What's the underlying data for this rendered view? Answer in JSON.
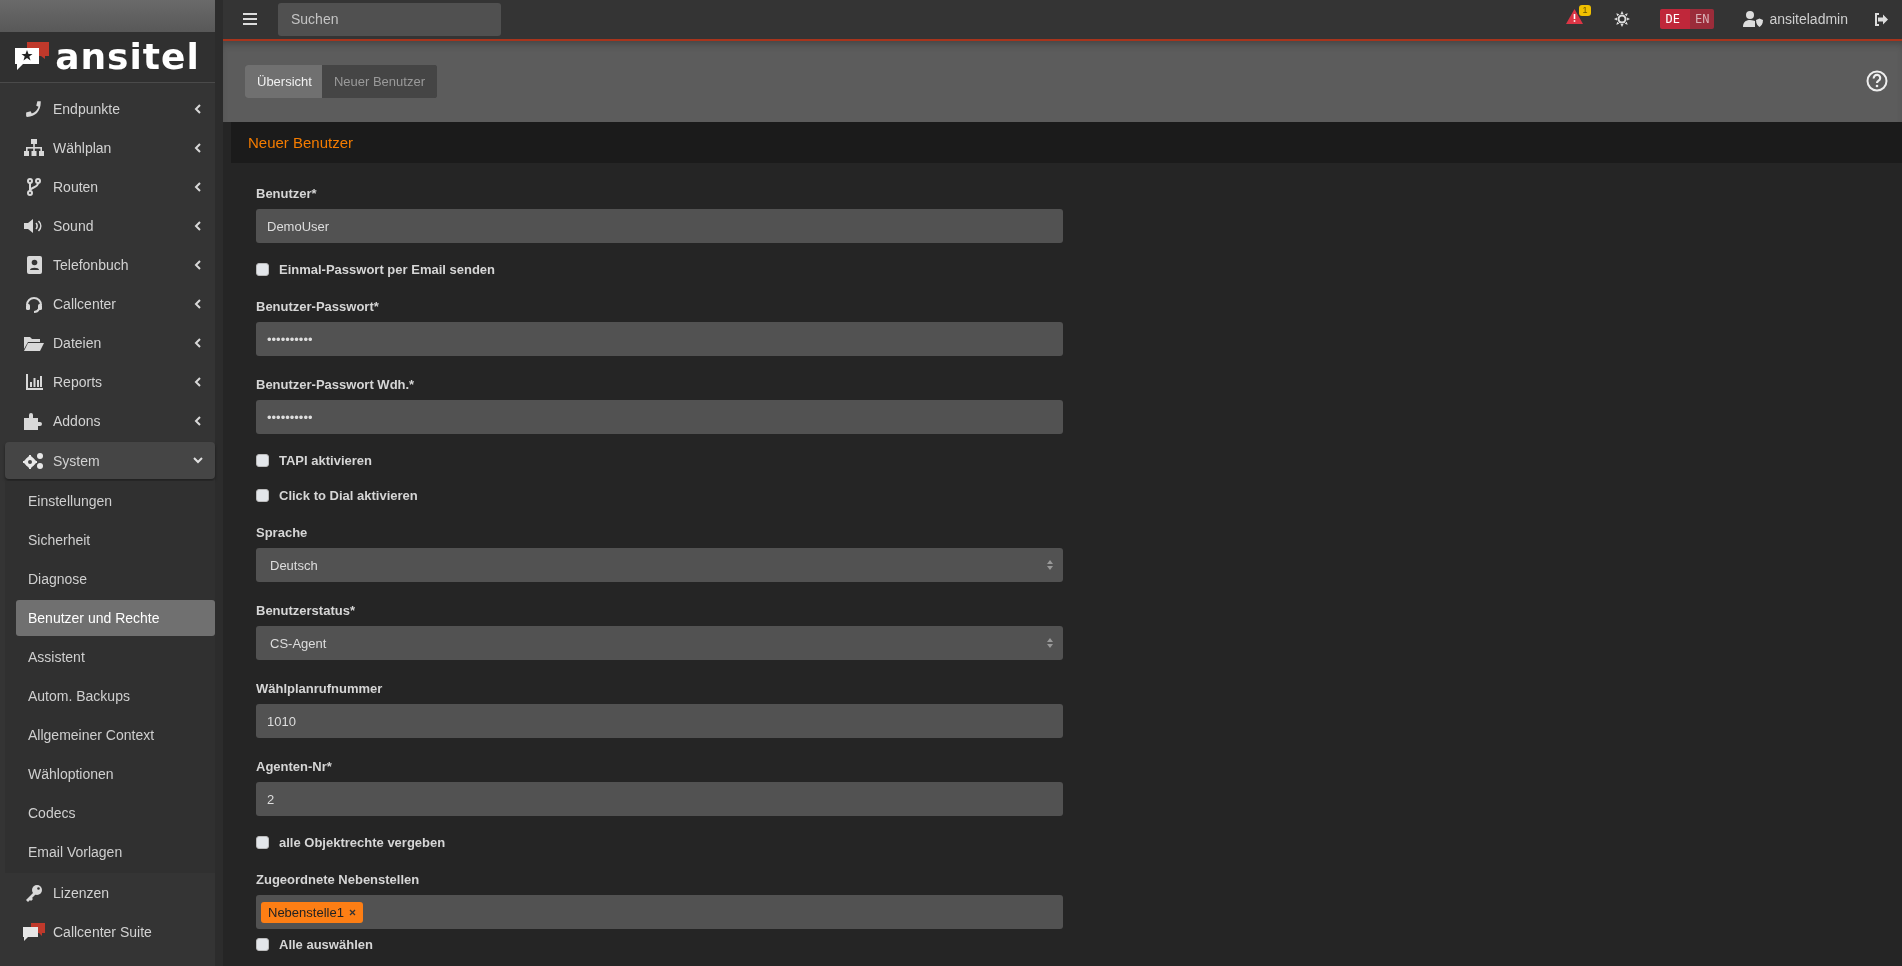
{
  "sidebar": {
    "logo": "ansitel",
    "items": [
      {
        "kind": "group",
        "label": "Endpunkte",
        "expanded": false
      },
      {
        "kind": "group",
        "label": "Wählplan",
        "expanded": false
      },
      {
        "kind": "group",
        "label": "Routen",
        "expanded": false
      },
      {
        "kind": "group",
        "label": "Sound",
        "expanded": false
      },
      {
        "kind": "group",
        "label": "Telefonbuch",
        "expanded": false
      },
      {
        "kind": "group",
        "label": "Callcenter",
        "expanded": false
      },
      {
        "kind": "group",
        "label": "Dateien",
        "expanded": false
      },
      {
        "kind": "group",
        "label": "Reports",
        "expanded": false
      },
      {
        "kind": "group",
        "label": "Addons",
        "expanded": false
      },
      {
        "kind": "group",
        "label": "System",
        "expanded": true,
        "children": [
          {
            "label": "Einstellungen",
            "selected": false
          },
          {
            "label": "Sicherheit",
            "selected": false
          },
          {
            "label": "Diagnose",
            "selected": false
          },
          {
            "label": "Benutzer und Rechte",
            "selected": true
          },
          {
            "label": "Assistent",
            "selected": false
          },
          {
            "label": "Autom. Backups",
            "selected": false
          },
          {
            "label": "Allgemeiner Context",
            "selected": false
          },
          {
            "label": "Wähloptionen",
            "selected": false
          },
          {
            "label": "Codecs",
            "selected": false
          },
          {
            "label": "Email Vorlagen",
            "selected": false
          }
        ]
      },
      {
        "kind": "link",
        "label": "Lizenzen"
      },
      {
        "kind": "link",
        "label": "Callcenter Suite"
      }
    ]
  },
  "topbar": {
    "search": {
      "placeholder": "Suchen"
    },
    "alert_count": "1",
    "languages": [
      {
        "label": "DE",
        "selected": true
      },
      {
        "label": "EN",
        "selected": false
      }
    ],
    "user": "ansiteladmin"
  },
  "tabs": [
    {
      "label": "Übersicht",
      "selected": true
    },
    {
      "label": "Neuer Benutzer",
      "selected": false
    }
  ],
  "form": {
    "title": "Neuer Benutzer",
    "fields": [
      {
        "kind": "text",
        "label": "Benutzer*",
        "value": "DemoUser"
      },
      {
        "kind": "checkbox",
        "label": "Einmal-Passwort per Email senden",
        "checked": false
      },
      {
        "kind": "text",
        "label": "Benutzer-Passwort*",
        "value": "••••••••••"
      },
      {
        "kind": "text",
        "label": "Benutzer-Passwort Wdh.*",
        "value": "••••••••••"
      },
      {
        "kind": "checkbox",
        "label": "TAPI aktivieren",
        "checked": false
      },
      {
        "kind": "checkbox",
        "label": "Click to Dial aktivieren",
        "checked": false
      },
      {
        "kind": "select",
        "label": "Sprache",
        "value": "Deutsch"
      },
      {
        "kind": "select",
        "label": "Benutzerstatus*",
        "value": "CS-Agent"
      },
      {
        "kind": "text",
        "label": "Wählplanrufnummer",
        "value": "1010"
      },
      {
        "kind": "text",
        "label": "Agenten-Nr*",
        "value": "2"
      },
      {
        "kind": "checkbox",
        "label": "alle Objektrechte vergeben",
        "checked": false
      },
      {
        "kind": "tags",
        "label": "Zugeordnete Nebenstellen",
        "tags": [
          "Nebenstelle1"
        ]
      },
      {
        "kind": "checkbox",
        "label": "Alle auswählen",
        "checked": false
      }
    ]
  }
}
